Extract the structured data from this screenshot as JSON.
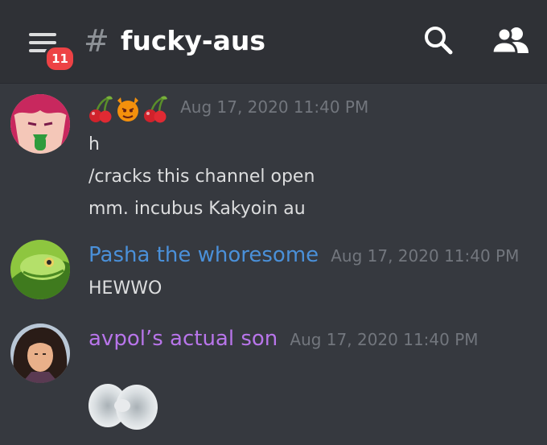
{
  "header": {
    "menu_icon": "hamburger-menu-icon",
    "badge_count": "11",
    "hash_symbol": "#",
    "channel_name": "fucky-aus",
    "search_icon": "search-icon",
    "members_icon": "members-icon"
  },
  "colors": {
    "background": "#36393f",
    "header": "#2f3136",
    "badge": "#ed4245",
    "timestamp": "#72767d",
    "user2": "#4a90d9",
    "user3": "#b875ea"
  },
  "messages": [
    {
      "username_emojis": [
        "cherry-emoji",
        "imp-emoji",
        "cherry-emoji"
      ],
      "timestamp": "Aug 17, 2020 11:40 PM",
      "lines": [
        "h",
        "/cracks this channel open",
        "mm. incubus Kakyoin au"
      ]
    },
    {
      "username": "Pasha the whoresome",
      "timestamp": "Aug 17, 2020 11:40 PM",
      "lines": [
        "HEWWO"
      ]
    },
    {
      "username": "avpol’s actual son",
      "timestamp": "Aug 17, 2020 11:40 PM",
      "lines": []
    }
  ]
}
